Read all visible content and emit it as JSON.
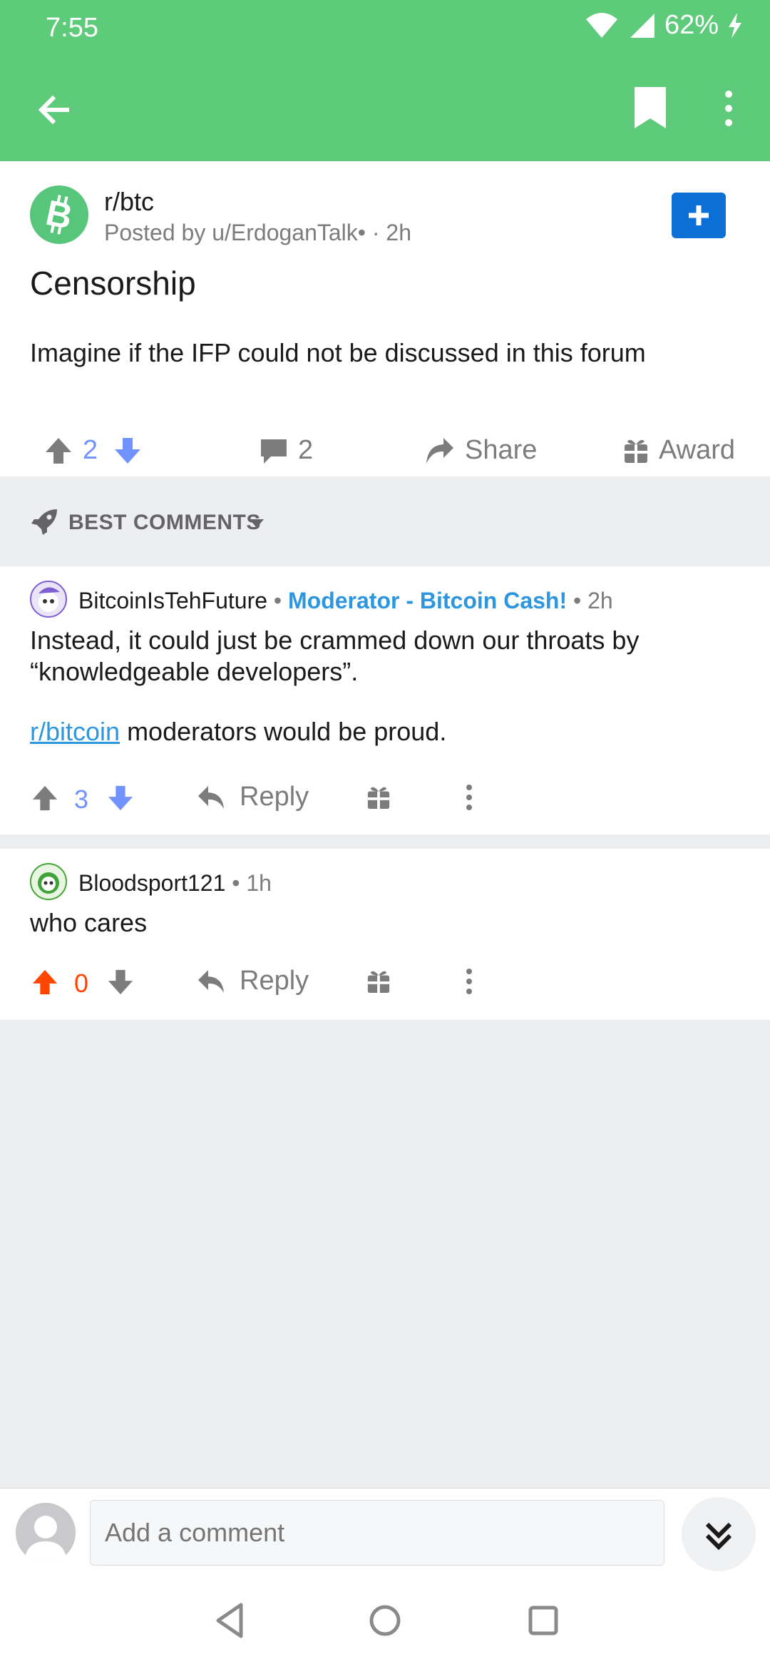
{
  "status_bar": {
    "time": "7:55",
    "battery": "62%"
  },
  "post": {
    "subreddit": "r/btc",
    "posted_by": "Posted by u/ErdoganTalk• · 2h",
    "title": "Censorship",
    "body": "Imagine if the IFP could not be discussed in this forum",
    "score": "2",
    "comment_count": "2",
    "share_label": "Share",
    "award_label": "Award"
  },
  "sort": {
    "label": "BEST COMMENTS"
  },
  "comments": [
    {
      "author": "BitcoinIsTehFuture",
      "flair": "Moderator - Bitcoin Cash!",
      "age": "2h",
      "body_line1": "Instead, it could just be crammed down our throats by “knowledgeable developers”.",
      "link": "r/bitcoin",
      "body_line2": " moderators would be proud.",
      "score": "3",
      "reply_label": "Reply"
    },
    {
      "author": "Bloodsport121",
      "age": "1h",
      "body": "who cares",
      "score": "0",
      "reply_label": "Reply"
    }
  ],
  "comment_bar": {
    "placeholder": "Add a comment"
  },
  "colors": {
    "brand_green": "#5ecb7a",
    "upvote_orange": "#ff4500",
    "score_blue": "#7193ff",
    "link_blue": "#2c97de"
  },
  "icons": [
    "back-arrow-icon",
    "bookmark-icon",
    "more-vertical-icon",
    "bitcoin-cash-icon",
    "plus-icon",
    "upvote-icon",
    "downvote-icon",
    "comment-icon",
    "share-icon",
    "gift-icon",
    "rocket-icon",
    "caret-down-icon",
    "reply-icon",
    "user-avatar-icon",
    "double-chevron-down-icon",
    "nav-back-icon",
    "nav-home-icon",
    "nav-recents-icon"
  ]
}
